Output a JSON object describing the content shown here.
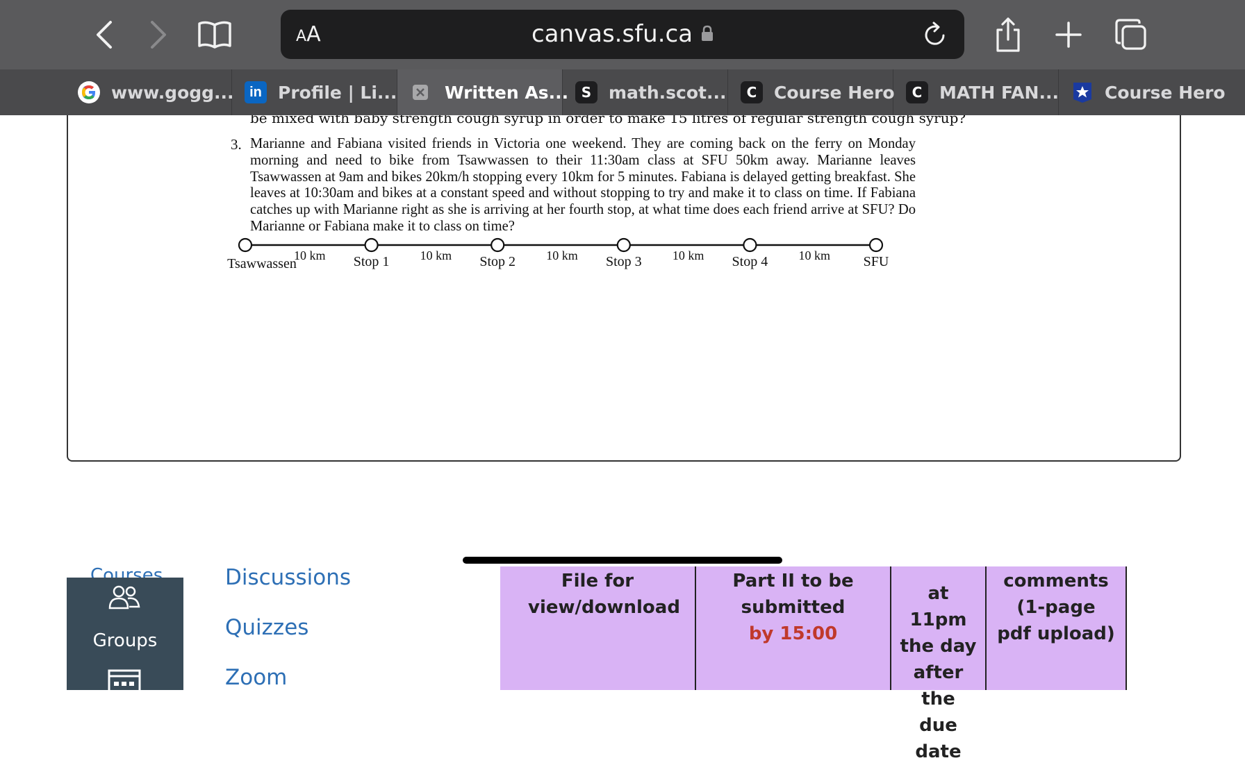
{
  "browser": {
    "aa_label_small": "A",
    "aa_label_large": "A",
    "url": "canvas.sfu.ca",
    "icons": [
      "back-icon",
      "forward-icon",
      "bookmarks-icon",
      "lock-icon",
      "reload-icon",
      "share-icon",
      "new-tab-icon",
      "tabs-overview-icon"
    ]
  },
  "tabs": [
    {
      "label": "www.gogg...",
      "icon": "google-icon",
      "active": false
    },
    {
      "label": "Profile | Li...",
      "icon": "linkedin-icon",
      "active": false
    },
    {
      "label": "Written As...",
      "icon": "close-tab-icon",
      "active": true
    },
    {
      "label": "math.scot...",
      "icon": "S",
      "active": false
    },
    {
      "label": "Course Hero",
      "icon": "C",
      "active": false
    },
    {
      "label": "MATH FAN...",
      "icon": "C",
      "active": false
    },
    {
      "label": "Course Hero",
      "icon": "star-badge-icon",
      "active": false
    }
  ],
  "pdf": {
    "previous_line": "be mixed with baby strength cough syrup in order to make 15 litres of regular strength cough syrup?",
    "question_number": "3.",
    "question_text": "Marianne and Fabiana visited friends in Victoria one weekend. They are coming back on the ferry on Monday morning and need to bike from Tsawwassen to their 11:30am class at SFU 50km away. Marianne leaves Tsawwassen at 9am and bikes 20km/h stopping every 10km for 5 minutes. Fabiana is delayed getting breakfast. She leaves at 10:30am and bikes at a constant speed and without stopping to try and make it to class on time. If Fabiana catches up with Marianne right as she is arriving at her fourth stop, at what time does each friend arrive at SFU? Do Marianne or Fabiana make it to class on time?",
    "route": {
      "stops": [
        "Tsawwassen",
        "Stop 1",
        "Stop 2",
        "Stop 3",
        "Stop 4",
        "SFU"
      ],
      "segment_label": "10 km"
    }
  },
  "canvas": {
    "nav_partial": "Courses",
    "groups_label": "Groups",
    "links": [
      "Discussions",
      "Quizzes",
      "Zoom"
    ],
    "table": {
      "col1": "File for view/download",
      "col2_main": "Part II to be submitted",
      "col2_red": "by 15:00",
      "col3": "at 11pm the day after the due date",
      "col4": "comments (1-page pdf upload)"
    },
    "accent_red": "#c0392b",
    "table_color": "#d9b3f5"
  }
}
